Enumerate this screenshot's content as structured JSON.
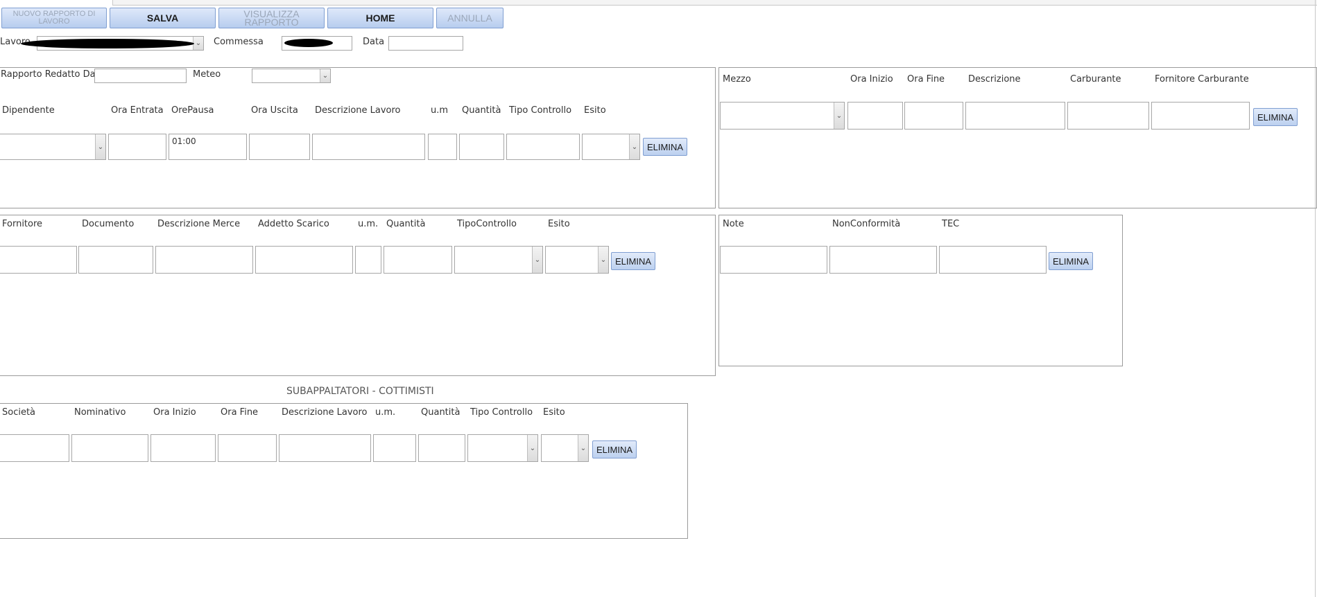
{
  "toolbar": {
    "nuovo": "NUOVO RAPPORTO DI LAVORO",
    "salva": "SALVA",
    "visualizza": "VISUALIZZA RAPPORTO",
    "home": "HOME",
    "annulla": "ANNULLA"
  },
  "header": {
    "lavoro_label": "Lavoro",
    "commessa_label": "Commessa",
    "data_label": "Data"
  },
  "personale": {
    "redatto_label": "Rapporto Redatto Da",
    "meteo_label": "Meteo",
    "columns": [
      "Dipendente",
      "Ora Entrata",
      "OrePausa",
      "Ora Uscita",
      "Descrizione Lavoro",
      "u.m",
      "Quantità",
      "Tipo Controllo",
      "Esito"
    ],
    "ore_pausa_value": "01:00",
    "delete": "ELIMINA"
  },
  "mezzi": {
    "columns": [
      "Mezzo",
      "Ora Inizio",
      "Ora Fine",
      "Descrizione",
      "Carburante",
      "Fornitore Carburante"
    ],
    "delete": "ELIMINA"
  },
  "forniture": {
    "columns": [
      "Fornitore",
      "Documento",
      "Descrizione Merce",
      "Addetto Scarico",
      "u.m.",
      "Quantità",
      "TipoControllo",
      "Esito"
    ],
    "delete": "ELIMINA"
  },
  "note": {
    "columns": [
      "Note",
      "NonConformità",
      "TEC"
    ],
    "delete": "ELIMINA"
  },
  "subappaltatori": {
    "title": "SUBAPPALTATORI - COTTIMISTI",
    "columns": [
      "Società",
      "Nominativo",
      "Ora Inizio",
      "Ora Fine",
      "Descrizione Lavoro",
      "u.m.",
      "Quantità",
      "Tipo Controllo",
      "Esito"
    ],
    "delete": "ELIMINA"
  }
}
